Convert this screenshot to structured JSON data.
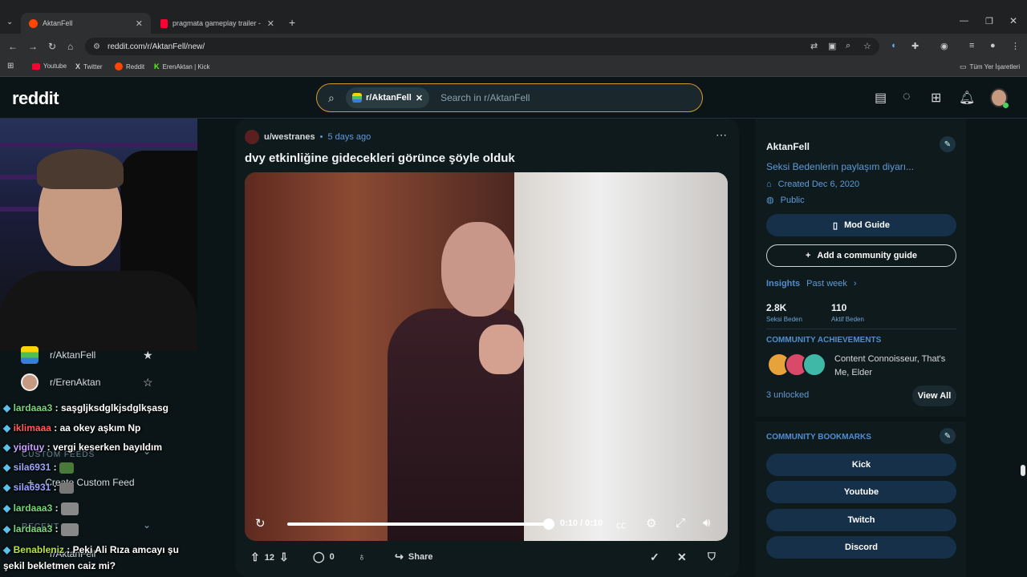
{
  "browser": {
    "tabs": [
      {
        "title": "AktanFell",
        "active": true
      },
      {
        "title": "pragmata gameplay trailer - YouTu",
        "active": false
      }
    ],
    "url": "reddit.com/r/AktanFell/new/",
    "bookmarks": [
      "Youtube",
      "Twitter",
      "Reddit",
      "ErenAktan | Kick"
    ],
    "all_bookmarks_label": "Tüm Yer İşaretleri"
  },
  "reddit": {
    "logo": "reddit",
    "search_chip": "r/AktanFell",
    "search_placeholder": "Search in r/AktanFell"
  },
  "left_sidebar": {
    "communities": [
      {
        "name": "r/AktanFell",
        "starred": true
      },
      {
        "name": "r/ErenAktan",
        "starred": false
      }
    ],
    "custom_feeds_label": "CUSTOM FEEDS",
    "create_custom_feed": "Create Custom Feed",
    "recent_label": "RECENT",
    "recent_item": "r/AktanFell"
  },
  "chat": [
    {
      "user": "lardaaa3",
      "msg": "saşgljksdglkjsdglkşasg"
    },
    {
      "user": "iklimaaa",
      "msg": "aa okey aşkım Np"
    },
    {
      "user": "yigituy",
      "msg": "vergi keserken bayıldım"
    },
    {
      "user": "sila6931",
      "msg": ""
    },
    {
      "user": "sila6931",
      "msg": ""
    },
    {
      "user": "lardaaa3",
      "msg": ""
    },
    {
      "user": "lardaaa3",
      "msg": ""
    },
    {
      "user": "Benableniz",
      "msg": "Peki Ali Rıza amcayı şu"
    },
    {
      "user": "",
      "msg": "şekil bekletmen caiz mi?"
    }
  ],
  "post": {
    "author": "u/westranes",
    "time": "5 days ago",
    "title": "dvy etkinliğine gidecekleri görünce şöyle olduk",
    "video_time": "0:10 / 0:10",
    "progress": 1.0,
    "score": "12",
    "comments": "0",
    "share_label": "Share"
  },
  "right_sidebar": {
    "community": "AktanFell",
    "description": "Seksi Bedenlerin paylaşım diyarı...",
    "created": "Created Dec 6, 2020",
    "visibility": "Public",
    "mod_guide": "Mod Guide",
    "add_guide": "Add a community guide",
    "insights_label": "Insights",
    "insights_range": "Past week",
    "stats": [
      {
        "value": "2.8K",
        "label": "Seksi Beden"
      },
      {
        "value": "110",
        "label": "Aktif Beden"
      }
    ],
    "achievements_header": "COMMUNITY ACHIEVEMENTS",
    "achievements_text": "Content Connoisseur, That's Me, Elder",
    "unlocked": "3 unlocked",
    "view_all": "View All",
    "bookmarks_header": "COMMUNITY BOOKMARKS",
    "bookmarks": [
      "Kick",
      "Youtube",
      "Twitch",
      "Discord"
    ]
  },
  "colors": {
    "accent": "#d19b2e",
    "link": "#5f9bd8",
    "button": "#16304a",
    "bg": "#0b1416"
  }
}
